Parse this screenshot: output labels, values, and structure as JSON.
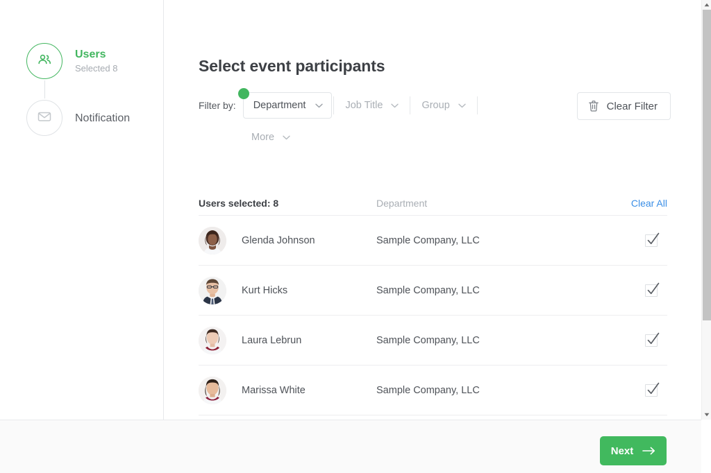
{
  "window": {
    "close_icon": "close-icon"
  },
  "sidebar": {
    "steps": [
      {
        "title": "Users",
        "sub": "Selected 8",
        "icon": "users-icon",
        "active": true
      },
      {
        "title": "Notification",
        "sub": "",
        "icon": "envelope-icon",
        "active": false
      }
    ]
  },
  "main": {
    "title": "Select event participants",
    "filter": {
      "label": "Filter by:",
      "selected": {
        "label": "Department",
        "has_badge": true
      },
      "options": [
        {
          "label": "Job Title"
        },
        {
          "label": "Group"
        }
      ],
      "more_label": "More",
      "clear_filter_label": "Clear Filter",
      "clear_filter_icon": "trash-icon",
      "chevron_icon": "chevron-down-icon",
      "badge_color": "#42b65f"
    },
    "list": {
      "header": {
        "selected_label": "Users selected: 8",
        "department_label": "Department",
        "clear_all_label": "Clear All"
      },
      "rows": [
        {
          "name": "Glenda Johnson",
          "department": "Sample Company, LLC",
          "checked": true,
          "avatar": "avatar-glenda"
        },
        {
          "name": "Kurt Hicks",
          "department": "Sample Company, LLC",
          "checked": true,
          "avatar": "avatar-kurt"
        },
        {
          "name": "Laura Lebrun",
          "department": "Sample Company, LLC",
          "checked": true,
          "avatar": "avatar-laura"
        },
        {
          "name": "Marissa White",
          "department": "Sample Company, LLC",
          "checked": true,
          "avatar": "avatar-marissa"
        }
      ]
    }
  },
  "footer": {
    "next_label": "Next",
    "next_icon": "arrow-right-icon",
    "next_color": "#41b95e"
  },
  "scrollbar": {
    "up_icon": "scroll-up-arrow-icon",
    "down_icon": "scroll-down-arrow-icon"
  }
}
